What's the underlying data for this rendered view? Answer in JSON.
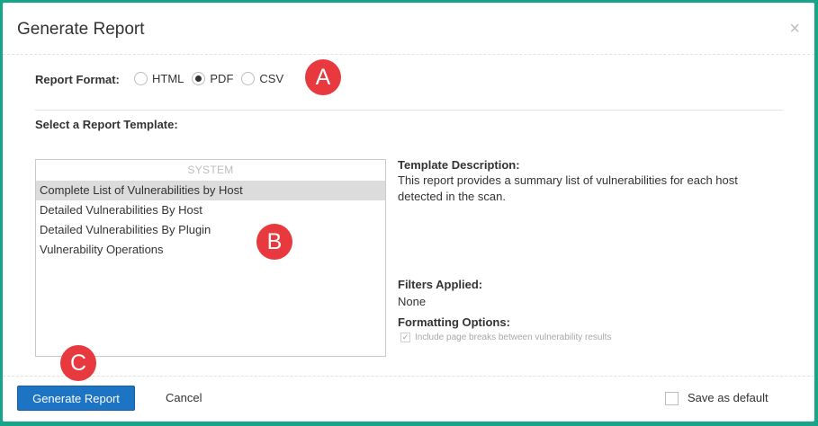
{
  "dialog": {
    "title": "Generate Report",
    "close_symbol": "×"
  },
  "report_format": {
    "label": "Report Format:",
    "options": [
      {
        "label": "HTML",
        "checked": false
      },
      {
        "label": "PDF",
        "checked": true
      },
      {
        "label": "CSV",
        "checked": false
      }
    ]
  },
  "template_section": {
    "label": "Select a Report Template:",
    "group_label": "SYSTEM",
    "items": [
      "Complete List of Vulnerabilities by Host",
      "Detailed Vulnerabilities By Host",
      "Detailed Vulnerabilities By Plugin",
      "Vulnerability Operations"
    ],
    "selected_index": 0
  },
  "description": {
    "label": "Template Description:",
    "text": "This report provides a summary list of vulnerabilities for each host detected in the scan.",
    "filters_label": "Filters Applied:",
    "filters_value": "None",
    "formatting_label": "Formatting Options:",
    "formatting_option": "Include page breaks between vulnerability results",
    "check_symbol": "✓"
  },
  "footer": {
    "generate_label": "Generate Report",
    "cancel_label": "Cancel",
    "save_default_label": "Save as default"
  },
  "markers": [
    "A",
    "B",
    "C"
  ],
  "colors": {
    "background": "#17a589",
    "primary_button": "#1d74c4",
    "marker": "#e8393f",
    "selected_row": "#dcdcdc"
  }
}
